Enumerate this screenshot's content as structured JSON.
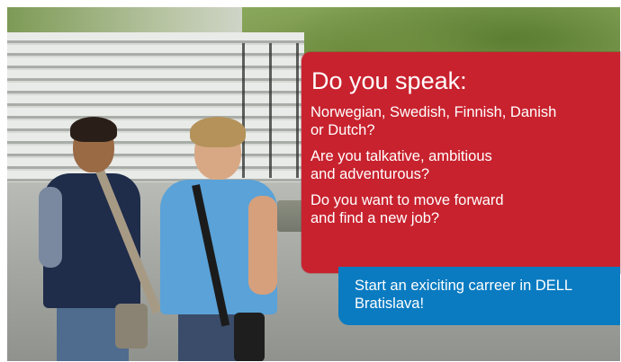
{
  "callout": {
    "heading": "Do you speak:",
    "paragraphs": [
      {
        "line1": "Norwegian, Swedish, Finnish, Danish",
        "line2": "or Dutch?"
      },
      {
        "line1": "Are you talkative, ambitious",
        "line2": "and adventurous?"
      },
      {
        "line1": "Do you want to move forward",
        "line2": "and find a new job?"
      }
    ]
  },
  "cta": {
    "line1": "Start an exiciting carreer in DELL",
    "line2": "Bratislava!"
  },
  "colors": {
    "red": "#c8222e",
    "blue": "#0a7bc1",
    "text": "#ffffff"
  }
}
